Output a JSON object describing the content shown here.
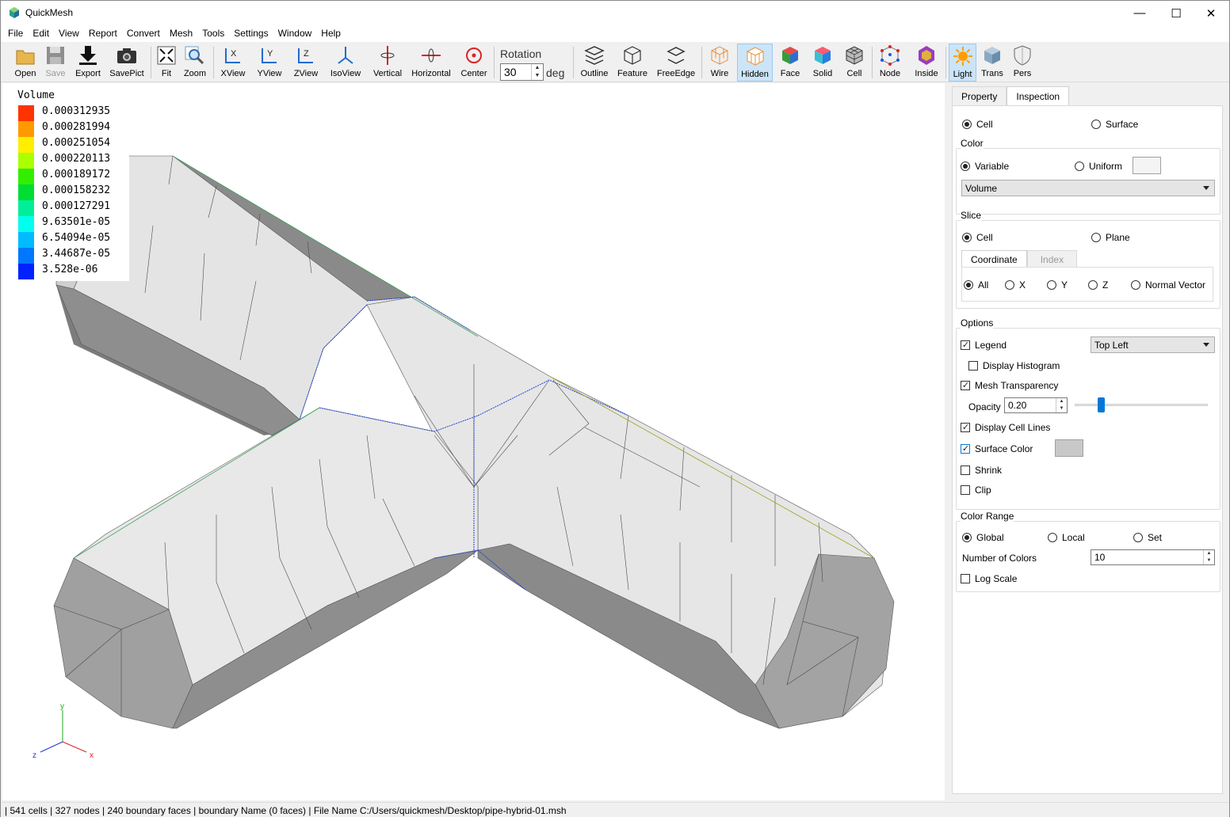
{
  "window": {
    "title": "QuickMesh",
    "minimize": "—",
    "maximize": "☐",
    "close": "✕"
  },
  "menu": [
    "File",
    "Edit",
    "View",
    "Report",
    "Convert",
    "Mesh",
    "Tools",
    "Settings",
    "Window",
    "Help"
  ],
  "toolbar": {
    "open": "Open",
    "save": "Save",
    "export": "Export",
    "savepict": "SavePict",
    "fit": "Fit",
    "zoom": "Zoom",
    "xview": "XView",
    "yview": "YView",
    "zview": "ZView",
    "isoview": "IsoView",
    "vertical": "Vertical",
    "horizontal": "Horizontal",
    "center": "Center",
    "rotation_label": "Rotation",
    "rotation_value": "30",
    "rotation_unit": "deg",
    "outline": "Outline",
    "feature": "Feature",
    "freeedge": "FreeEdge",
    "wire": "Wire",
    "hidden": "Hidden",
    "face": "Face",
    "solid": "Solid",
    "cell": "Cell",
    "node": "Node",
    "inside": "Inside",
    "light": "Light",
    "trans": "Trans",
    "pers": "Pers"
  },
  "legend": {
    "title": "Volume",
    "entries": [
      {
        "label": "0.000312935",
        "color": "#ff3300"
      },
      {
        "label": "0.000281994",
        "color": "#ff9900"
      },
      {
        "label": "0.000251054",
        "color": "#ffee00"
      },
      {
        "label": "0.000220113",
        "color": "#aaff00"
      },
      {
        "label": "0.000189172",
        "color": "#33ee00"
      },
      {
        "label": "0.000158232",
        "color": "#00dd33"
      },
      {
        "label": "0.000127291",
        "color": "#00ee99"
      },
      {
        "label": "9.63501e-05",
        "color": "#00ffee"
      },
      {
        "label": "6.54094e-05",
        "color": "#00bbff"
      },
      {
        "label": "3.44687e-05",
        "color": "#0077ff"
      },
      {
        "label": "3.528e-06",
        "color": "#0022ff"
      }
    ]
  },
  "axes": {
    "x": "x",
    "y": "y",
    "z": "z"
  },
  "panel": {
    "tabs": [
      "Property",
      "Inspection"
    ],
    "display_cell": "Cell",
    "display_surface": "Surface",
    "color_group": "Color",
    "color_variable": "Variable",
    "color_uniform": "Uniform",
    "variable_select": "Volume",
    "slice_group": "Slice",
    "slice_cell": "Cell",
    "slice_plane": "Plane",
    "slice_tabs": [
      "Coordinate",
      "Index"
    ],
    "coord_all": "All",
    "coord_x": "X",
    "coord_y": "Y",
    "coord_z": "Z",
    "coord_normal": "Normal Vector",
    "options_group": "Options",
    "legend": "Legend",
    "legend_pos": "Top Left",
    "display_histogram": "Display Histogram",
    "mesh_transparency": "Mesh Transparency",
    "opacity_label": "Opacity",
    "opacity_value": "0.20",
    "display_cell_lines": "Display Cell Lines",
    "surface_color": "Surface Color",
    "shrink": "Shrink",
    "clip": "Clip",
    "range_group": "Color Range",
    "range_global": "Global",
    "range_local": "Local",
    "range_set": "Set",
    "num_colors_label": "Number of Colors",
    "num_colors_value": "10",
    "log_scale": "Log Scale"
  },
  "status": "| 541 cells | 327 nodes | 240 boundary faces |  boundary Name  (0 faces) | File Name C:/Users/quickmesh/Desktop/pipe-hybrid-01.msh"
}
